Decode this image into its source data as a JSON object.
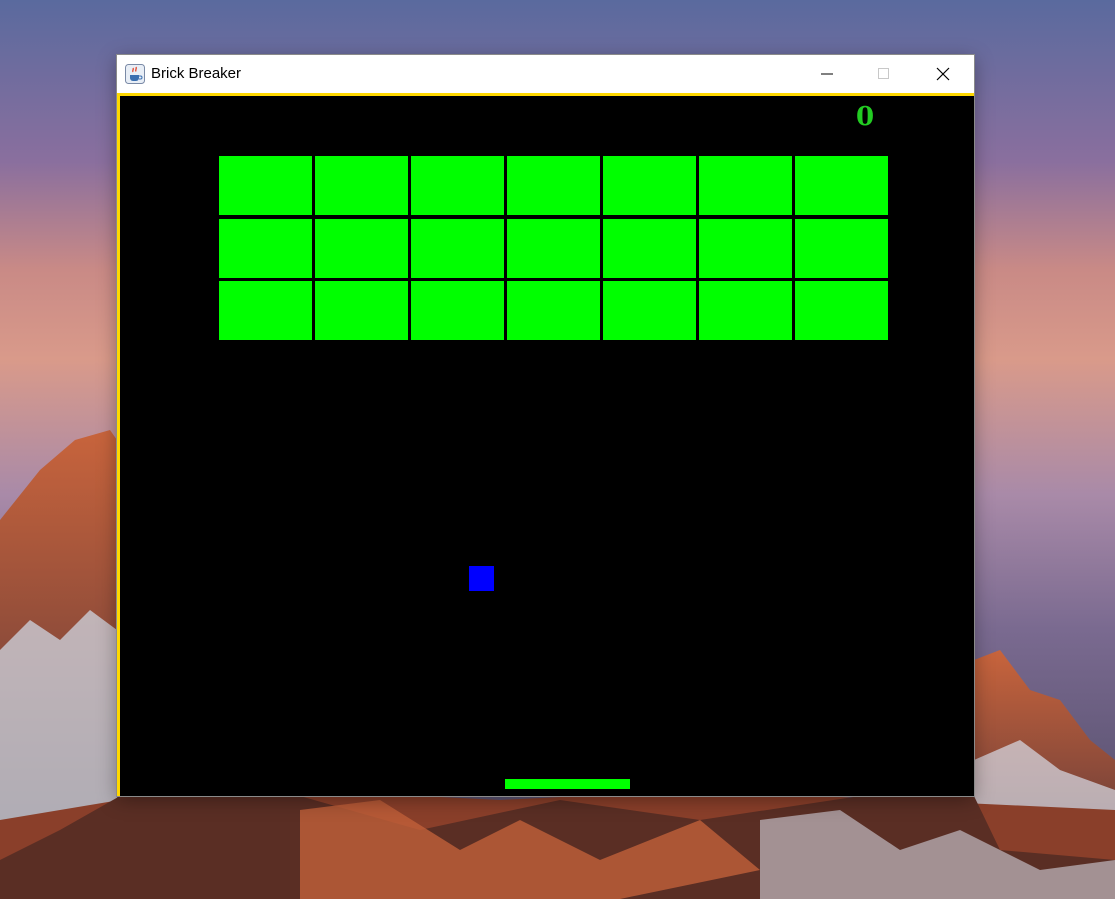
{
  "window": {
    "title": "Brick Breaker",
    "icon": "java-coffee-cup-icon",
    "controls": [
      "minimize-icon",
      "maximize-icon",
      "close-icon"
    ]
  },
  "game": {
    "score": "0",
    "bricks": {
      "rows": 3,
      "columns": 7,
      "remaining": 21
    },
    "colors": {
      "background": "#000000",
      "border": "#ffd800",
      "brick": "#00ff00",
      "paddle": "#00ff00",
      "ball": "#0000ff",
      "score": "#22cc22"
    }
  }
}
